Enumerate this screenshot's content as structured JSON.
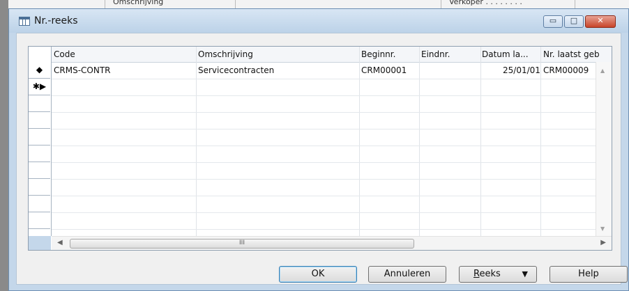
{
  "background": {
    "text_left": "Omschrijving",
    "text_right": "Verkoper . . . . . . . ."
  },
  "window": {
    "title": "Nr.-reeks",
    "controls": {
      "minimize": "▭",
      "maximize": "□",
      "close": "✕"
    }
  },
  "grid": {
    "columns": [
      "Code",
      "Omschrijving",
      "Beginnr.",
      "Eindnr.",
      "Datum la...",
      "Nr. laatst geb"
    ],
    "rows": [
      {
        "selector": "◆",
        "code": "CRMS-CONTR",
        "description": "Servicecontracten",
        "start": "CRM00001",
        "end": "",
        "date": "25/01/01",
        "last_no": "CRM00009"
      },
      {
        "selector": "✱▶",
        "code": "",
        "description": "",
        "start": "",
        "end": "",
        "date": "",
        "last_no": ""
      }
    ],
    "hscroll_thumb": "III"
  },
  "buttons": {
    "ok": "OK",
    "cancel": "Annuleren",
    "reeks_first": "R",
    "reeks_rest": "eeks",
    "help": "Help"
  }
}
